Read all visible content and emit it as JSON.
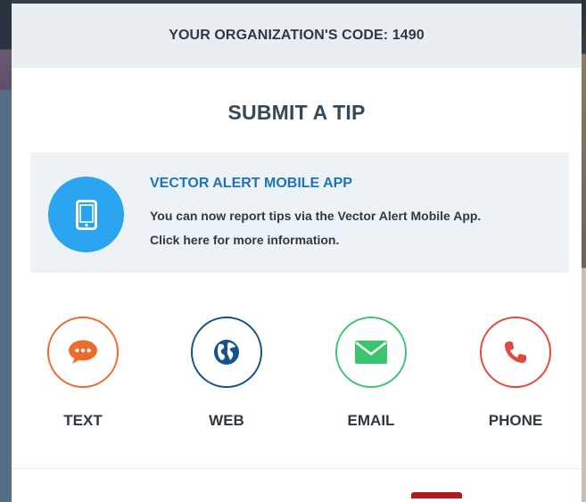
{
  "org_code_text": "YOUR ORGANIZATION'S CODE: 1490",
  "title": "SUBMIT A TIP",
  "app_promo": {
    "icon": "tablet-icon",
    "heading": "VECTOR ALERT MOBILE APP",
    "line1": "You can now report tips via the Vector Alert Mobile App.",
    "line2": "Click here for more information."
  },
  "options": [
    {
      "label": "TEXT",
      "icon": "chat-bubble-icon",
      "color": "#ec6b2d"
    },
    {
      "label": "WEB",
      "icon": "globe-icon",
      "color": "#14528a"
    },
    {
      "label": "EMAIL",
      "icon": "envelope-icon",
      "color": "#3cc56e"
    },
    {
      "label": "PHONE",
      "icon": "phone-icon",
      "color": "#e04a3e"
    }
  ],
  "colors": {
    "header_bg": "#e9eef2",
    "card_bg": "#edf2f6",
    "app_icon_bg": "#2ba4f0",
    "app_heading": "#1e73be"
  }
}
